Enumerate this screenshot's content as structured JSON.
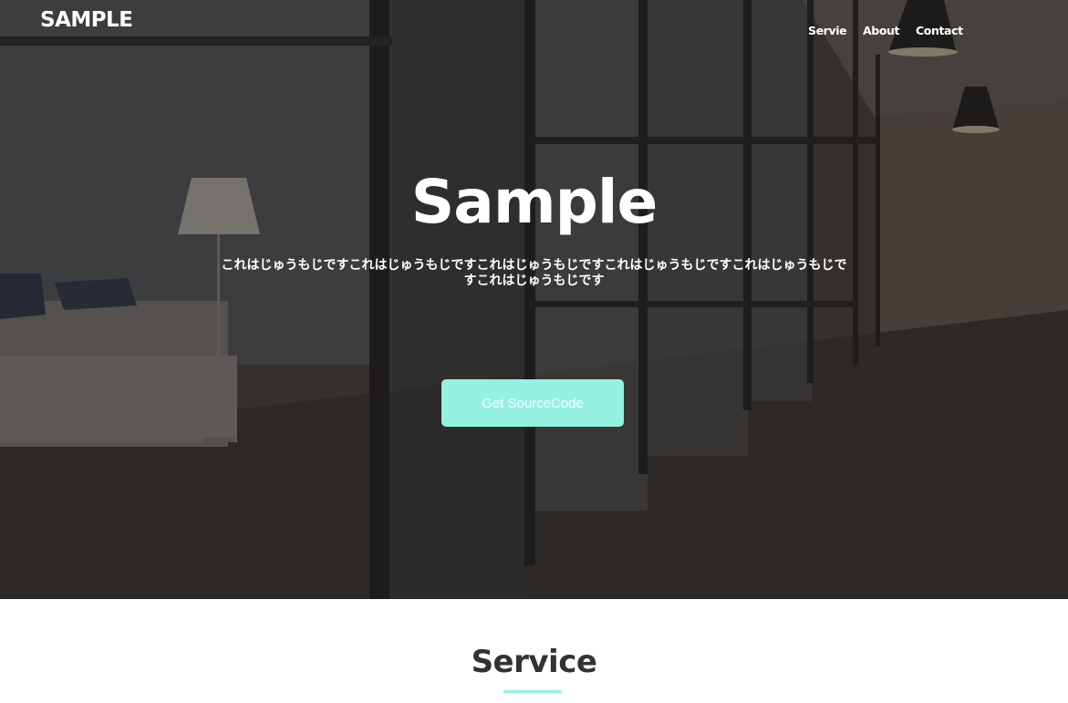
{
  "header": {
    "logo": "SAMPLE",
    "nav": [
      "Servie",
      "About",
      "Contact"
    ]
  },
  "hero": {
    "title": "Sample",
    "text": "これはじゅうもじですこれはじゅうもじですこれはじゅうもじですこれはじゅうもじですこれはじゅうもじですこれはじゅうもじです",
    "button": "Get SourceCode"
  },
  "service": {
    "title": "Service"
  },
  "colors": {
    "accent": "#95f2e3",
    "overlay": "#2b2826",
    "text_dark": "#333333"
  },
  "icons": {
    "hero_background": "office-interior-photo"
  }
}
